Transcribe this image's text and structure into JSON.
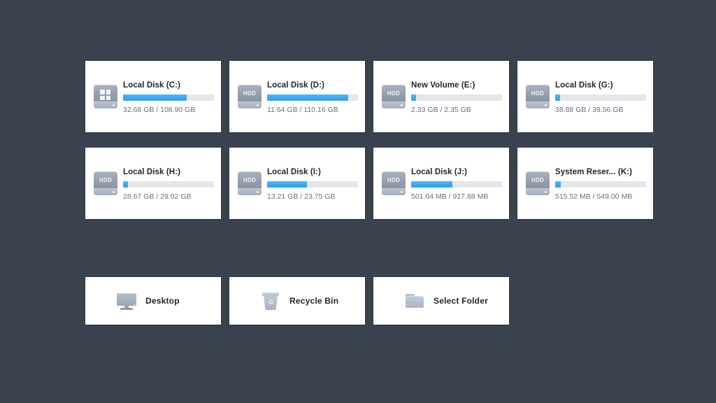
{
  "window": {
    "background_color": "#3a4250",
    "card_background": "#ffffff",
    "accent_color": "#2f9bf0",
    "bar_track_color": "#e4e7eb"
  },
  "drives": [
    {
      "name": "Local Disk (C:)",
      "capacity_text": "32.68 GB / 108.90 GB",
      "free": "32.68 GB",
      "total": "108.90 GB",
      "used_percent": 70,
      "icon": "windows-drive-icon",
      "icon_label": ""
    },
    {
      "name": "Local Disk (D:)",
      "capacity_text": "11.64 GB / 110.16 GB",
      "free": "11.64 GB",
      "total": "110.16 GB",
      "used_percent": 89,
      "icon": "hdd-icon",
      "icon_label": "HDD"
    },
    {
      "name": "New Volume (E:)",
      "capacity_text": "2.33 GB / 2.35 GB",
      "free": "2.33 GB",
      "total": "2.35 GB",
      "used_percent": 5,
      "icon": "hdd-icon",
      "icon_label": "HDD"
    },
    {
      "name": "Local Disk (G:)",
      "capacity_text": "38.88 GB / 39.56 GB",
      "free": "38.88 GB",
      "total": "39.56 GB",
      "used_percent": 5,
      "icon": "hdd-icon",
      "icon_label": "HDD"
    },
    {
      "name": "Local Disk (H:)",
      "capacity_text": "28.67 GB / 29.02 GB",
      "free": "28.67 GB",
      "total": "29.02 GB",
      "used_percent": 5,
      "icon": "hdd-icon",
      "icon_label": "HDD"
    },
    {
      "name": "Local Disk (I:)",
      "capacity_text": "13.21 GB / 23.75 GB",
      "free": "13.21 GB",
      "total": "23.75 GB",
      "used_percent": 44,
      "icon": "hdd-icon",
      "icon_label": "HDD"
    },
    {
      "name": "Local Disk (J:)",
      "capacity_text": "501.04 MB / 917.88 MB",
      "free": "501.04 MB",
      "total": "917.88 MB",
      "used_percent": 45,
      "icon": "hdd-icon",
      "icon_label": "HDD"
    },
    {
      "name": "System Reser... (K:)",
      "capacity_text": "515.52 MB / 549.00 MB",
      "free": "515.52 MB",
      "total": "549.00 MB",
      "used_percent": 6,
      "icon": "hdd-icon",
      "icon_label": "HDD"
    }
  ],
  "shortcuts": [
    {
      "label": "Desktop",
      "icon": "monitor-icon"
    },
    {
      "label": "Recycle Bin",
      "icon": "recycle-bin-icon"
    },
    {
      "label": "Select Folder",
      "icon": "folder-icon"
    }
  ]
}
